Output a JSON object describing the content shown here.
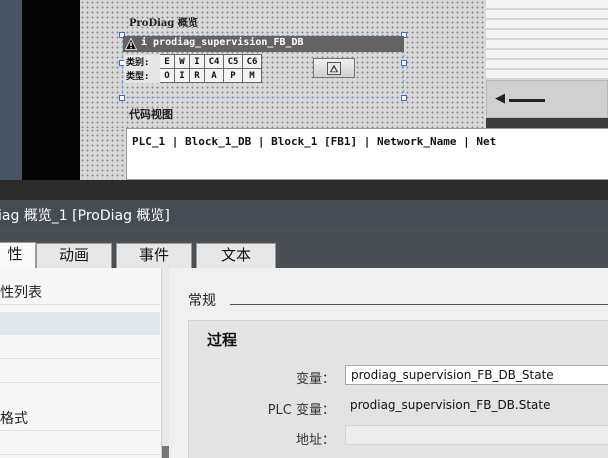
{
  "editor": {
    "overview_title": "ProDiag 概览",
    "prodiag_widget": {
      "name": "i prodiag_supervision_FB_DB",
      "row1_label": "类别:",
      "row1_cells": [
        "E",
        "W",
        "I",
        "C4",
        "C5",
        "C6"
      ],
      "row2_label": "类型:",
      "row2_cells": [
        "O",
        "I",
        "R",
        "A",
        "P",
        "M"
      ]
    },
    "code_view_title": "代码视图",
    "code_line": "PLC_1 | Block_1_DB | Block_1 [FB1] | Network_Name | Net"
  },
  "inspector": {
    "title": "iag 概览_1 [ProDiag 概览]",
    "tabs": [
      {
        "label": "性",
        "active": true
      },
      {
        "label": "动画",
        "active": false
      },
      {
        "label": "事件",
        "active": false
      },
      {
        "label": "文本",
        "active": false
      }
    ],
    "nav_items": [
      "性列表",
      "",
      "",
      "",
      "格式",
      ""
    ],
    "section_label": "常规",
    "group_title": "过程",
    "fields": [
      {
        "label": "变量：",
        "value": "prodiag_supervision_FB_DB_State",
        "kind": "input"
      },
      {
        "label": "PLC 变量：",
        "value": "prodiag_supervision_FB_DB.State",
        "kind": "text"
      },
      {
        "label": "地址：",
        "value": "",
        "kind": "readonly"
      }
    ]
  },
  "colors": {
    "title_bar": "#454c54",
    "canvas": "#d9d9d9",
    "widget_header": "#636363",
    "selection": "#3a6ed6"
  }
}
